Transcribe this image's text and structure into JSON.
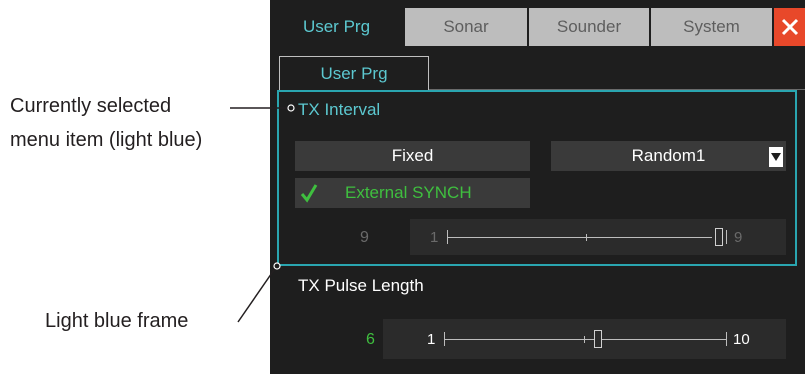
{
  "tabs": [
    {
      "label": "User Prg"
    },
    {
      "label": "Sonar"
    },
    {
      "label": "Sounder"
    },
    {
      "label": "System"
    }
  ],
  "close_icon": "close-x-icon",
  "subtab": {
    "label": "User Prg"
  },
  "tx_interval": {
    "label": "TX Interval",
    "fixed_label": "Fixed",
    "random_label": "Random1",
    "external_synch_label": "External SYNCH",
    "external_synch_checked": true,
    "slider": {
      "value": "9",
      "min": "1",
      "max": "9",
      "level": 9
    }
  },
  "tx_pulse_length": {
    "label": "TX Pulse Length",
    "slider": {
      "value": "6",
      "min": "1",
      "max": "10",
      "level": 6
    }
  },
  "annotations": {
    "selected_line1": "Currently selected",
    "selected_line2": "menu item (light blue)",
    "frame_label": "Light blue frame"
  },
  "colors": {
    "accent_light_blue": "#5cc8d0",
    "frame_blue": "#2aa6b0",
    "check_green": "#3fbf3f",
    "close_red": "#e8482a",
    "panel_bg": "#1e1e1e"
  }
}
